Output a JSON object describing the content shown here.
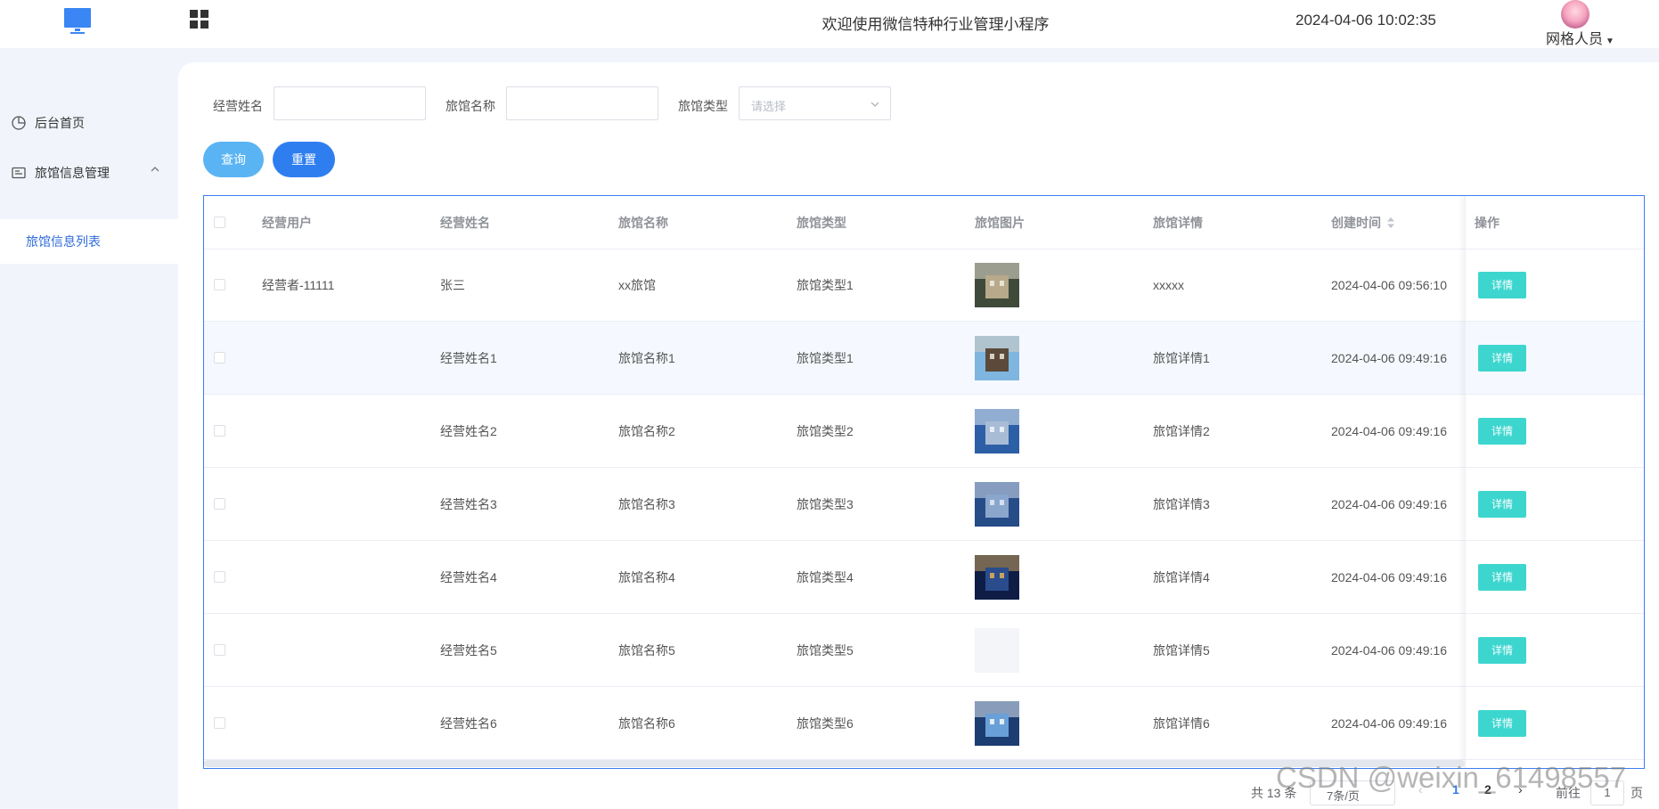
{
  "header": {
    "welcome": "欢迎使用微信特种行业管理小程序",
    "datetime": "2024-04-06 10:02:35",
    "user": "网格人员"
  },
  "sidebar": {
    "items": [
      {
        "label": "后台首页",
        "icon": "clock-icon"
      },
      {
        "label": "旅馆信息管理",
        "icon": "id-card-icon"
      }
    ],
    "sub_items": [
      {
        "label": "旅馆信息列表"
      }
    ]
  },
  "filters": {
    "owner_name_label": "经营姓名",
    "hotel_name_label": "旅馆名称",
    "hotel_type_label": "旅馆类型",
    "hotel_type_placeholder": "请选择",
    "query_label": "查询",
    "reset_label": "重置"
  },
  "table": {
    "columns": [
      "经营用户",
      "经营姓名",
      "旅馆名称",
      "旅馆类型",
      "旅馆图片",
      "旅馆详情",
      "创建时间",
      "操作"
    ],
    "rows": [
      {
        "user": "经营者-11111",
        "name": "张三",
        "hotel": "xx旅馆",
        "type": "旅馆类型1",
        "detail": "xxxxx",
        "created": "2024-04-06 09:56:10",
        "action": "详情"
      },
      {
        "user": "",
        "name": "经营姓名1",
        "hotel": "旅馆名称1",
        "type": "旅馆类型1",
        "detail": "旅馆详情1",
        "created": "2024-04-06 09:49:16",
        "action": "详情"
      },
      {
        "user": "",
        "name": "经营姓名2",
        "hotel": "旅馆名称2",
        "type": "旅馆类型2",
        "detail": "旅馆详情2",
        "created": "2024-04-06 09:49:16",
        "action": "详情"
      },
      {
        "user": "",
        "name": "经营姓名3",
        "hotel": "旅馆名称3",
        "type": "旅馆类型3",
        "detail": "旅馆详情3",
        "created": "2024-04-06 09:49:16",
        "action": "详情"
      },
      {
        "user": "",
        "name": "经营姓名4",
        "hotel": "旅馆名称4",
        "type": "旅馆类型4",
        "detail": "旅馆详情4",
        "created": "2024-04-06 09:49:16",
        "action": "详情"
      },
      {
        "user": "",
        "name": "经营姓名5",
        "hotel": "旅馆名称5",
        "type": "旅馆类型5",
        "detail": "旅馆详情5",
        "created": "2024-04-06 09:49:16",
        "action": "详情"
      },
      {
        "user": "",
        "name": "经营姓名6",
        "hotel": "旅馆名称6",
        "type": "旅馆类型6",
        "detail": "旅馆详情6",
        "created": "2024-04-06 09:49:16",
        "action": "详情"
      }
    ]
  },
  "pagination": {
    "total": "共 13 条",
    "page_size": "7条/页",
    "pages": [
      "1",
      "2"
    ],
    "current_page": "1",
    "goto_label": "前往",
    "goto_value": "1",
    "page_suffix": "页"
  },
  "watermark": "CSDN @weixin_61498557",
  "colors": {
    "primary": "#2f7ef0",
    "query": "#5ab4f3",
    "detail": "#3dd6cf",
    "sidebar_active": "#2f6bdb",
    "background": "#f1f5fb"
  }
}
